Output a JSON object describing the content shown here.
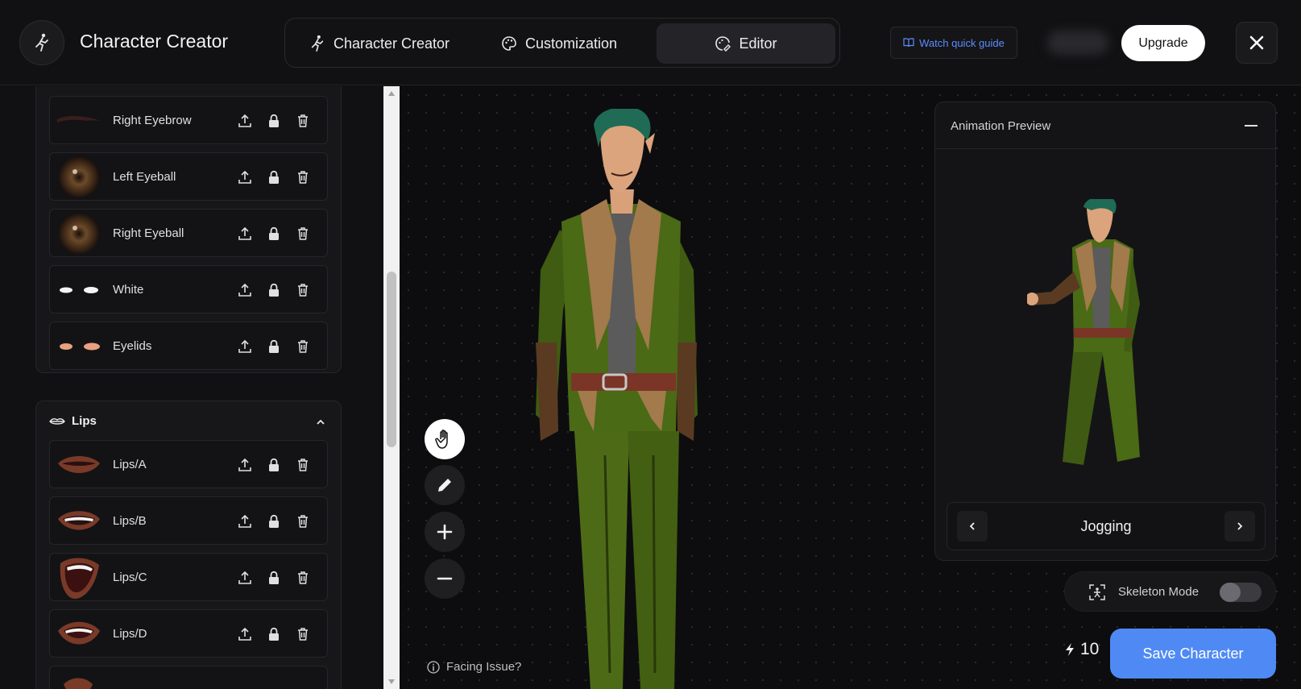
{
  "header": {
    "app_title": "Character Creator",
    "tabs": [
      {
        "label": "Character Creator",
        "icon": "running-person-icon"
      },
      {
        "label": "Customization",
        "icon": "palette-icon"
      },
      {
        "label": "Editor",
        "icon": "edit-palette-icon",
        "active": true
      }
    ],
    "guide_label": "Watch quick guide",
    "upgrade_label": "Upgrade"
  },
  "sidebar": {
    "eyes_layers": [
      {
        "name": "Right Eyebrow",
        "thumb": "eyebrow"
      },
      {
        "name": "Left Eyeball",
        "thumb": "eyeball"
      },
      {
        "name": "Right Eyeball",
        "thumb": "eyeball"
      },
      {
        "name": "White",
        "thumb": "white"
      },
      {
        "name": "Eyelids",
        "thumb": "eyelids"
      }
    ],
    "lips_section": {
      "title": "Lips",
      "layers": [
        {
          "name": "Lips/A",
          "thumb": "lips-a"
        },
        {
          "name": "Lips/B",
          "thumb": "lips-b"
        },
        {
          "name": "Lips/C",
          "thumb": "lips-c"
        },
        {
          "name": "Lips/D",
          "thumb": "lips-d"
        }
      ]
    }
  },
  "canvas": {
    "tools": [
      "hand-icon",
      "pencil-icon",
      "zoom-in-icon",
      "zoom-out-icon"
    ],
    "facing_issue": "Facing Issue?"
  },
  "preview": {
    "title": "Animation Preview",
    "animation_name": "Jogging",
    "skeleton_label": "Skeleton Mode",
    "skeleton_on": false
  },
  "footer": {
    "credits": "10",
    "save_label": "Save Character"
  },
  "colors": {
    "accent": "#4f8af4",
    "link": "#5b8cff"
  }
}
